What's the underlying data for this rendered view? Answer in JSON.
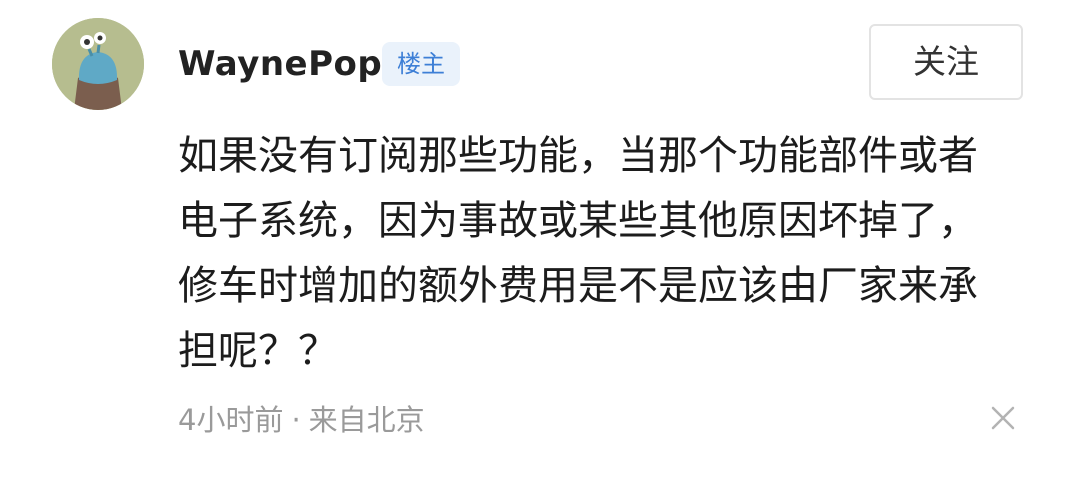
{
  "comment": {
    "avatar_icon": "avatar-image",
    "username": "WaynePop",
    "op_badge": "楼主",
    "follow_label": "关注",
    "content": "如果没有订阅那些功能，当那个功能部件或者电子系统，因为事故或某些其他原因坏掉了，修车时增加的额外费用是不是应该由厂家来承担呢？？",
    "time": "4小时前",
    "separator": "·",
    "location": "来自北京",
    "close_icon": "close-icon"
  },
  "colors": {
    "badge_bg": "#eaf2fb",
    "badge_text": "#3d7fd6",
    "meta_text": "#9a9a9a"
  }
}
